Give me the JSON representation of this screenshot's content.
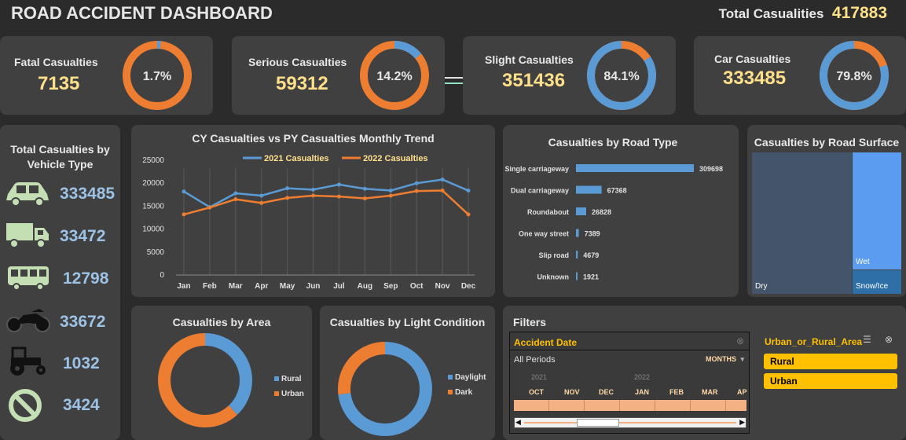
{
  "header": {
    "title": "ROAD ACCIDENT DASHBOARD",
    "total_label": "Total Casualities",
    "total_value": "417883"
  },
  "kpis": [
    {
      "label": "Fatal Casualties",
      "value": "7135",
      "pct": "1.7%"
    },
    {
      "label": "Serious Casualties",
      "value": "59312",
      "pct": "14.2%"
    },
    {
      "label": "Slight Casualties",
      "value": "351436",
      "pct": "84.1%"
    },
    {
      "label": "Car Casualties",
      "value": "333485",
      "pct": "79.8%"
    }
  ],
  "vehicle": {
    "title_line1": "Total Casualties by",
    "title_line2": "Vehicle Type",
    "items": [
      {
        "icon": "car-icon",
        "value": "333485"
      },
      {
        "icon": "truck-icon",
        "value": "33472"
      },
      {
        "icon": "bus-icon",
        "value": "12798"
      },
      {
        "icon": "motorcycle-icon",
        "value": "33672"
      },
      {
        "icon": "tractor-icon",
        "value": "1032"
      },
      {
        "icon": "no-entry-icon",
        "value": "3424"
      }
    ]
  },
  "colors": {
    "blue": "#5b9bd5",
    "orange": "#ed7d31",
    "gold": "#ffc000",
    "value_yellow": "#ffe08a"
  },
  "chart_data": [
    {
      "type": "line",
      "title": "CY Casualties vs PY Casualties Monthly Trend",
      "categories": [
        "Jan",
        "Feb",
        "Mar",
        "Apr",
        "May",
        "Jun",
        "Jul",
        "Aug",
        "Sep",
        "Oct",
        "Nov",
        "Dec"
      ],
      "series": [
        {
          "name": "2021 Casualties",
          "values": [
            18200,
            14800,
            17800,
            17300,
            18900,
            18600,
            19700,
            18800,
            18400,
            20000,
            20800,
            18400
          ]
        },
        {
          "name": "2022 Casualties",
          "values": [
            13200,
            14700,
            16500,
            15700,
            16800,
            17300,
            17100,
            16700,
            17300,
            18300,
            18400,
            13200
          ]
        }
      ],
      "ylim": [
        0,
        25000
      ],
      "yticks": [
        "0",
        "5000",
        "10000",
        "15000",
        "20000",
        "25000"
      ]
    },
    {
      "type": "bar",
      "title": "Casualties by Road Type",
      "categories": [
        "Single carriageway",
        "Dual carriageway",
        "Roundabout",
        "One way street",
        "Slip road",
        "Unknown"
      ],
      "values": [
        309698,
        67368,
        26828,
        7389,
        4679,
        1921
      ]
    },
    {
      "type": "heatmap",
      "title": "Casualties by Road Surface",
      "categories": [
        "Dry",
        "Wet",
        "Snow/Ice"
      ]
    },
    {
      "type": "pie",
      "title": "Casualties by Area",
      "categories": [
        "Rural",
        "Urban"
      ],
      "values": [
        38,
        62
      ]
    },
    {
      "type": "pie",
      "title": "Casualties by Light Condition",
      "categories": [
        "Daylight",
        "Dark"
      ],
      "values": [
        73,
        27
      ]
    }
  ],
  "filters": {
    "title": "Filters",
    "date_slicer": {
      "label": "Accident Date",
      "period": "All Periods",
      "level": "MONTHS",
      "years": [
        "2021",
        "2022"
      ],
      "months": [
        "OCT",
        "NOV",
        "DEC",
        "JAN",
        "FEB",
        "MAR",
        "AP"
      ]
    },
    "area_slicer": {
      "label": "Urban_or_Rural_Area",
      "items": [
        "Rural",
        "Urban"
      ]
    }
  }
}
